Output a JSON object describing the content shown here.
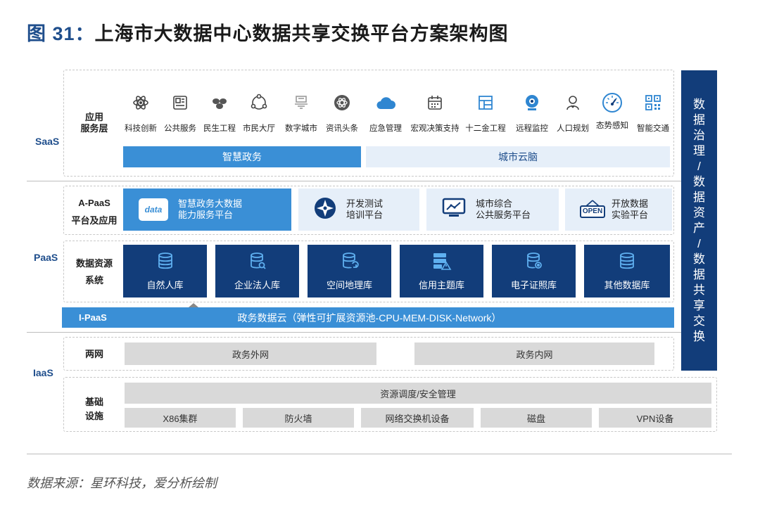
{
  "title": {
    "prefix": "图 31：",
    "text": "上海市大数据中心数据共享交换平台方案架构图"
  },
  "layers": {
    "saas": "SaaS",
    "paas": "PaaS",
    "iaas": "IaaS"
  },
  "row_labels": {
    "app_layer": [
      "应用",
      "服务层"
    ],
    "apaas": [
      "A-PaaS",
      "平台及应用"
    ],
    "data_resource": [
      "数据资源",
      "系统"
    ],
    "ipaas": "I-PaaS",
    "two_networks": "两网",
    "infrastructure": [
      "基础",
      "设施"
    ]
  },
  "apps": [
    {
      "label": "科技创新",
      "icon": "atom-icon"
    },
    {
      "label": "公共服务",
      "icon": "id-card-icon"
    },
    {
      "label": "民生工程",
      "icon": "people-icon"
    },
    {
      "label": "市民大厅",
      "icon": "cycle-icon"
    },
    {
      "label": "数字城市",
      "icon": "city-icon"
    },
    {
      "label": "资讯头条",
      "icon": "news-icon"
    },
    {
      "label": "应急管理",
      "icon": "cloud-icon"
    },
    {
      "label": "宏观决策支持",
      "icon": "calendar-icon"
    },
    {
      "label": "十二金工程",
      "icon": "grid-icon"
    },
    {
      "label": "远程监控",
      "icon": "camera-icon"
    },
    {
      "label": "人口规划",
      "icon": "person-icon"
    },
    {
      "label": "态势感知",
      "icon": "gauge-icon"
    },
    {
      "label": "智能交通",
      "icon": "qrcode-icon"
    }
  ],
  "saas_bars": {
    "left": "智慧政务",
    "right": "城市云脑"
  },
  "apaas_cards": [
    {
      "lines": [
        "智慧政务大数据",
        "能力服务平台"
      ],
      "icon": "data-icon",
      "icon_text": "data"
    },
    {
      "lines": [
        "开发测试",
        "培训平台"
      ],
      "icon": "compass-icon"
    },
    {
      "lines": [
        "城市综合",
        "公共服务平台"
      ],
      "icon": "monitor-chart-icon"
    },
    {
      "lines": [
        "开放数据",
        "实验平台"
      ],
      "icon": "open-sign-icon",
      "icon_text": "OPEN"
    }
  ],
  "databases": [
    "自然人库",
    "企业法人库",
    "空间地理库",
    "信用主题库",
    "电子证照库",
    "其他数据库"
  ],
  "ipaas_bar": "政务数据云（弹性可扩展资源池-CPU-MEM-DISK-Network）",
  "networks": [
    "政务外网",
    "政务内网"
  ],
  "infra_top": "资源调度/安全管理",
  "infra_items": [
    "X86集群",
    "防火墙",
    "网络交换机设备",
    "磁盘",
    "VPN设备"
  ],
  "side_label": [
    "数",
    "据",
    "治",
    "理",
    "/",
    "数",
    "据",
    "资",
    "产",
    "/",
    "数",
    "据",
    "共",
    "享",
    "交",
    "换"
  ],
  "source": "数据来源：星环科技，爱分析绘制",
  "colors": {
    "dark_blue": "#123d7a",
    "mid_blue": "#3a8fd6",
    "light_blue": "#e6eff9",
    "gray": "#d9d9d9"
  }
}
